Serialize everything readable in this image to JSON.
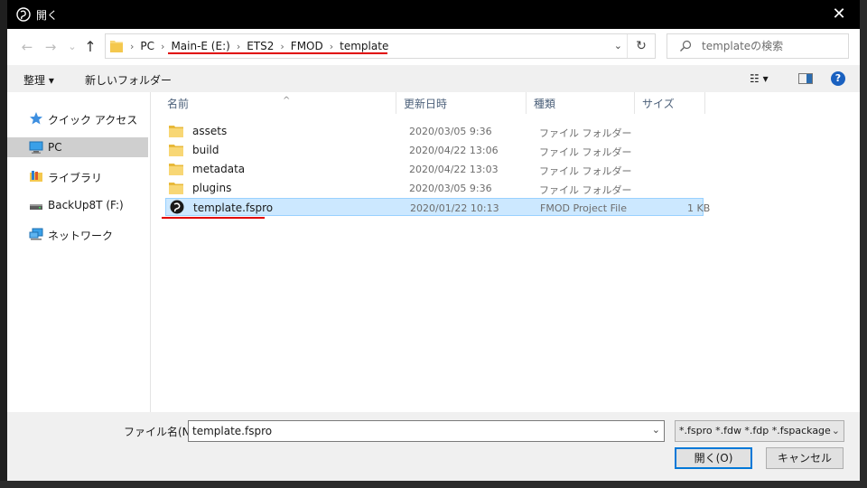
{
  "window": {
    "title": "開く",
    "close_glyph": "✕"
  },
  "nav": {
    "back_glyph": "←",
    "forward_glyph": "→",
    "recent_glyph": "⌄",
    "up_glyph": "↑"
  },
  "breadcrumb": {
    "separator": "›",
    "items": [
      "PC",
      "Main-E (E:)",
      "ETS2",
      "FMOD",
      "template"
    ],
    "dropdown_glyph": "⌄",
    "refresh_glyph": "↻"
  },
  "search": {
    "placeholder": "templateの検索"
  },
  "toolbar": {
    "organize_label": "整理 ▾",
    "new_folder_label": "新しいフォルダー",
    "view_glyph": "☷ ▾",
    "help_label": "?"
  },
  "sidebar": {
    "items": [
      {
        "label": "クイック アクセス",
        "icon": "star-icon"
      },
      {
        "label": "PC",
        "icon": "monitor-icon"
      },
      {
        "label": "ライブラリ",
        "icon": "library-icon"
      },
      {
        "label": "BackUp8T (F:)",
        "icon": "drive-icon"
      },
      {
        "label": "ネットワーク",
        "icon": "network-icon"
      }
    ],
    "selected_index": 1
  },
  "files": {
    "sort_glyph": "^",
    "columns": {
      "name": "名前",
      "date": "更新日時",
      "type": "種類",
      "size": "サイズ"
    },
    "rows": [
      {
        "name": "assets",
        "date": "2020/03/05 9:36",
        "type": "ファイル フォルダー",
        "size": "",
        "icon": "folder-icon"
      },
      {
        "name": "build",
        "date": "2020/04/22 13:06",
        "type": "ファイル フォルダー",
        "size": "",
        "icon": "folder-icon"
      },
      {
        "name": "metadata",
        "date": "2020/04/22 13:03",
        "type": "ファイル フォルダー",
        "size": "",
        "icon": "folder-icon"
      },
      {
        "name": "plugins",
        "date": "2020/03/05 9:36",
        "type": "ファイル フォルダー",
        "size": "",
        "icon": "folder-icon"
      },
      {
        "name": "template.fspro",
        "date": "2020/01/22 10:13",
        "type": "FMOD Project File",
        "size": "1 KB",
        "icon": "fmod-icon"
      }
    ],
    "selected_index": 4
  },
  "bottom": {
    "filename_label": "ファイル名(N):",
    "filename_value": "template.fspro",
    "filetype_value": "*.fspro *.fdw *.fdp *.fspackage",
    "dropdown_glyph": "⌄",
    "open_label": "開く(O)",
    "cancel_label": "キャンセル"
  },
  "colors": {
    "selection": "#cce8ff",
    "annotation": "#e00000",
    "accent": "#0078d7"
  }
}
